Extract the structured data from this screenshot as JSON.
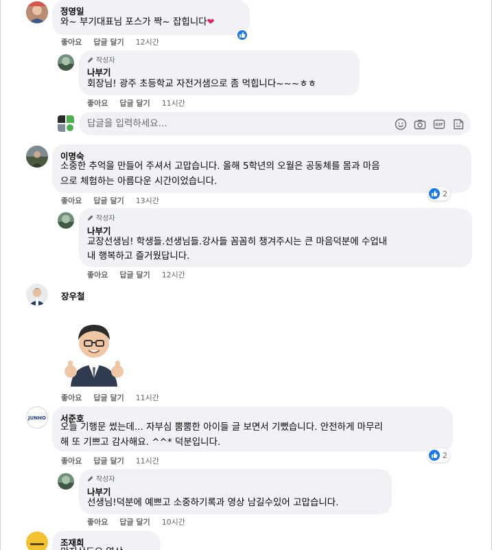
{
  "comments": [
    {
      "author": "정영일",
      "lines": [
        "와~ 부기대표님 포스가 짝~ 잡힙니다"
      ],
      "emoji": "heart",
      "actions": {
        "like": "좋아요",
        "reply": "답글 달기",
        "time": "12시간"
      },
      "reply": {
        "badge": "작성자",
        "author": "나부기",
        "lines": [
          "회장님! 광주 초등학교 자전거샘으로 좀 먹힙니다~~~ㅎㅎ"
        ],
        "actions": {
          "like": "좋아요",
          "reply": "답글 달기",
          "time": "11시간"
        }
      }
    },
    {
      "author": "이명숙",
      "lines": [
        "소중한 추억을 만들어 주셔서 고맙습니다. 올해 5학년의 오월은 공동체를 몸과 마음",
        "으로 체험하는 아름다운 시간이었습니다."
      ],
      "reaction_count": "2",
      "actions": {
        "like": "좋아요",
        "reply": "답글 달기",
        "time": "13시간"
      },
      "reply": {
        "badge": "작성자",
        "author": "나부기",
        "lines": [
          "교장선생님! 학생들.선생님들.강사들 꼼꼼히 챙겨주시는 큰 마음덕분에 수업내",
          "내 행복하고 즐거웠답니다."
        ],
        "actions": {
          "like": "좋아요",
          "reply": "답글 달기",
          "time": "12시간"
        }
      }
    },
    {
      "author": "장우철",
      "sticker": "thumbs-up-avatar-sticker",
      "actions": {
        "like": "좋아요",
        "reply": "답글 달기",
        "time": "11시간"
      }
    },
    {
      "author": "서준호",
      "avatar_text": "JUNHO",
      "lines": [
        "오늘 기행문 썼는데... 자부심 뿜뿜한 아이들 글 보면서 기뻤습니다. 안전하게 마무리",
        "해 또 기쁘고 감사해요. ^^* 덕분입니다."
      ],
      "reaction_count": "2",
      "actions": {
        "like": "좋아요",
        "reply": "답글 달기",
        "time": "11시간"
      },
      "reply": {
        "badge": "작성자",
        "author": "나부기",
        "lines": [
          "선생님!덕분에 예쁘고 소중하기록과 영상 남길수있어 고맙습니다."
        ],
        "actions": {
          "like": "좋아요",
          "reply": "답글 달기",
          "time": "10시간"
        }
      }
    },
    {
      "author": "조재희",
      "lines": [
        "만지산도요 영상"
      ]
    }
  ],
  "reply_input": {
    "placeholder": "답글을 입력하세요...",
    "tools": [
      "emoji-icon",
      "camera-icon",
      "gif-icon",
      "sticker-icon"
    ]
  },
  "colors": {
    "bubble": "#f0f2f5",
    "meta": "#65676b",
    "like": "#1877f2"
  }
}
